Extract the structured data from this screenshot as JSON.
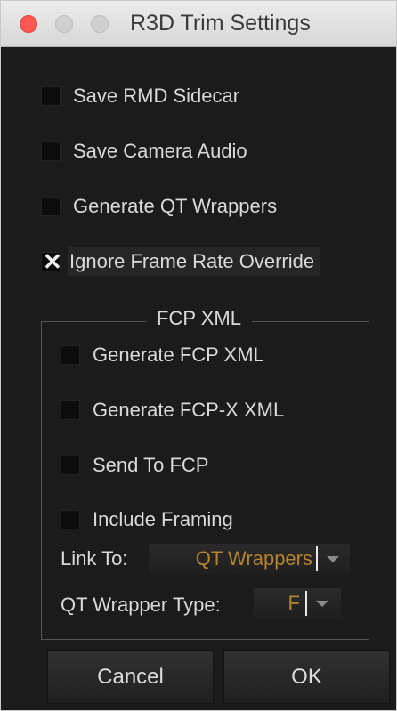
{
  "window": {
    "title": "R3D Trim Settings"
  },
  "options": {
    "save_rmd_sidecar": {
      "label": "Save RMD Sidecar",
      "checked": false
    },
    "save_camera_audio": {
      "label": "Save Camera Audio",
      "checked": false
    },
    "generate_qt_wrappers": {
      "label": "Generate QT Wrappers",
      "checked": false
    },
    "ignore_frame_rate_override": {
      "label": "Ignore Frame Rate Override",
      "checked": true,
      "mark": "✕"
    }
  },
  "fcp_xml": {
    "group_title": "FCP XML",
    "generate_fcp_xml": {
      "label": "Generate FCP XML",
      "checked": false
    },
    "generate_fcpx_xml": {
      "label": "Generate FCP-X XML",
      "checked": false
    },
    "send_to_fcp": {
      "label": "Send To FCP",
      "checked": false
    },
    "include_framing": {
      "label": "Include Framing",
      "checked": false
    },
    "link_to": {
      "label": "Link To:",
      "value": "QT Wrappers"
    },
    "qt_wrapper_type": {
      "label": "QT Wrapper Type:",
      "value": "F"
    }
  },
  "buttons": {
    "cancel": "Cancel",
    "ok": "OK"
  },
  "colors": {
    "background": "#1b1b1b",
    "text": "#dadada",
    "accent_value": "#b7832f",
    "close_button": "#fc5753"
  }
}
